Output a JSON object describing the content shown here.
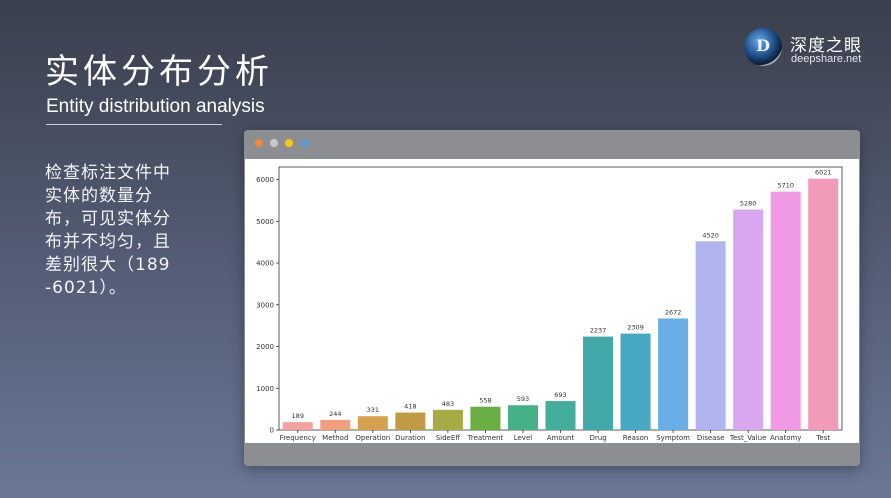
{
  "slide": {
    "title": "实体分布分析",
    "subtitle": "Entity distribution analysis",
    "description": "检查标注文件中实体的数量分布，可见实体分布并不均匀，且差别很大（189-6021）。"
  },
  "brand": {
    "logo_letter": "D",
    "name": "深度之眼",
    "url": "deepshare.net"
  },
  "window_dots": [
    "#f0883e",
    "#c8c8c8",
    "#f5c518",
    "#5b9bd5"
  ],
  "chart_data": {
    "type": "bar",
    "categories": [
      "Frequency",
      "Method",
      "Operation",
      "Duration",
      "SideEff",
      "Treatment",
      "Level",
      "Amount",
      "Drug",
      "Reason",
      "Symptom",
      "Disease",
      "Test_Value",
      "Anatomy",
      "Test"
    ],
    "values": [
      189,
      244,
      331,
      418,
      483,
      558,
      593,
      693,
      2237,
      2309,
      2672,
      4520,
      5280,
      5710,
      6021
    ],
    "colors": [
      "#f2a3a0",
      "#f0a07f",
      "#d4a24f",
      "#c19a45",
      "#a6ab45",
      "#6bae44",
      "#46b089",
      "#44ad9c",
      "#43a8a8",
      "#47a8c4",
      "#6aaee8",
      "#b2b4f0",
      "#d8a7ef",
      "#f09ae6",
      "#f29ab9"
    ],
    "yticks": [
      0,
      1000,
      2000,
      3000,
      4000,
      5000,
      6000
    ],
    "ylim": [
      0,
      6300
    ],
    "title": "",
    "xlabel": "",
    "ylabel": "",
    "grid": false
  }
}
